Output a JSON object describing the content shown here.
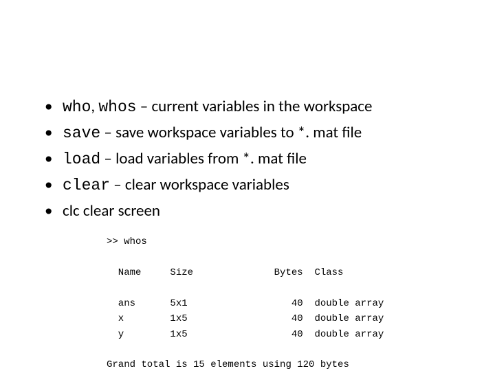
{
  "bullets": [
    {
      "cmd1": "who",
      "sep1": ", ",
      "cmd2": "whos",
      "rest": " – current variables in the workspace"
    },
    {
      "cmd1": "save",
      "rest": " – save workspace variables to *. mat file"
    },
    {
      "cmd1": "load",
      "rest": " – load variables from *. mat file"
    },
    {
      "cmd1": "clear",
      "rest": " – clear workspace variables"
    },
    {
      "plain": "clc  clear screen"
    }
  ],
  "terminal": {
    "prompt": ">> whos",
    "header": {
      "name": "Name",
      "size": "Size",
      "bytes": "Bytes",
      "class": "Class"
    },
    "rows": [
      {
        "name": "ans",
        "size": "5x1",
        "bytes": "40",
        "class": "double array"
      },
      {
        "name": "x",
        "size": "1x5",
        "bytes": "40",
        "class": "double array"
      },
      {
        "name": "y",
        "size": "1x5",
        "bytes": "40",
        "class": "double array"
      }
    ],
    "footer": "Grand total is 15 elements using 120 bytes"
  }
}
